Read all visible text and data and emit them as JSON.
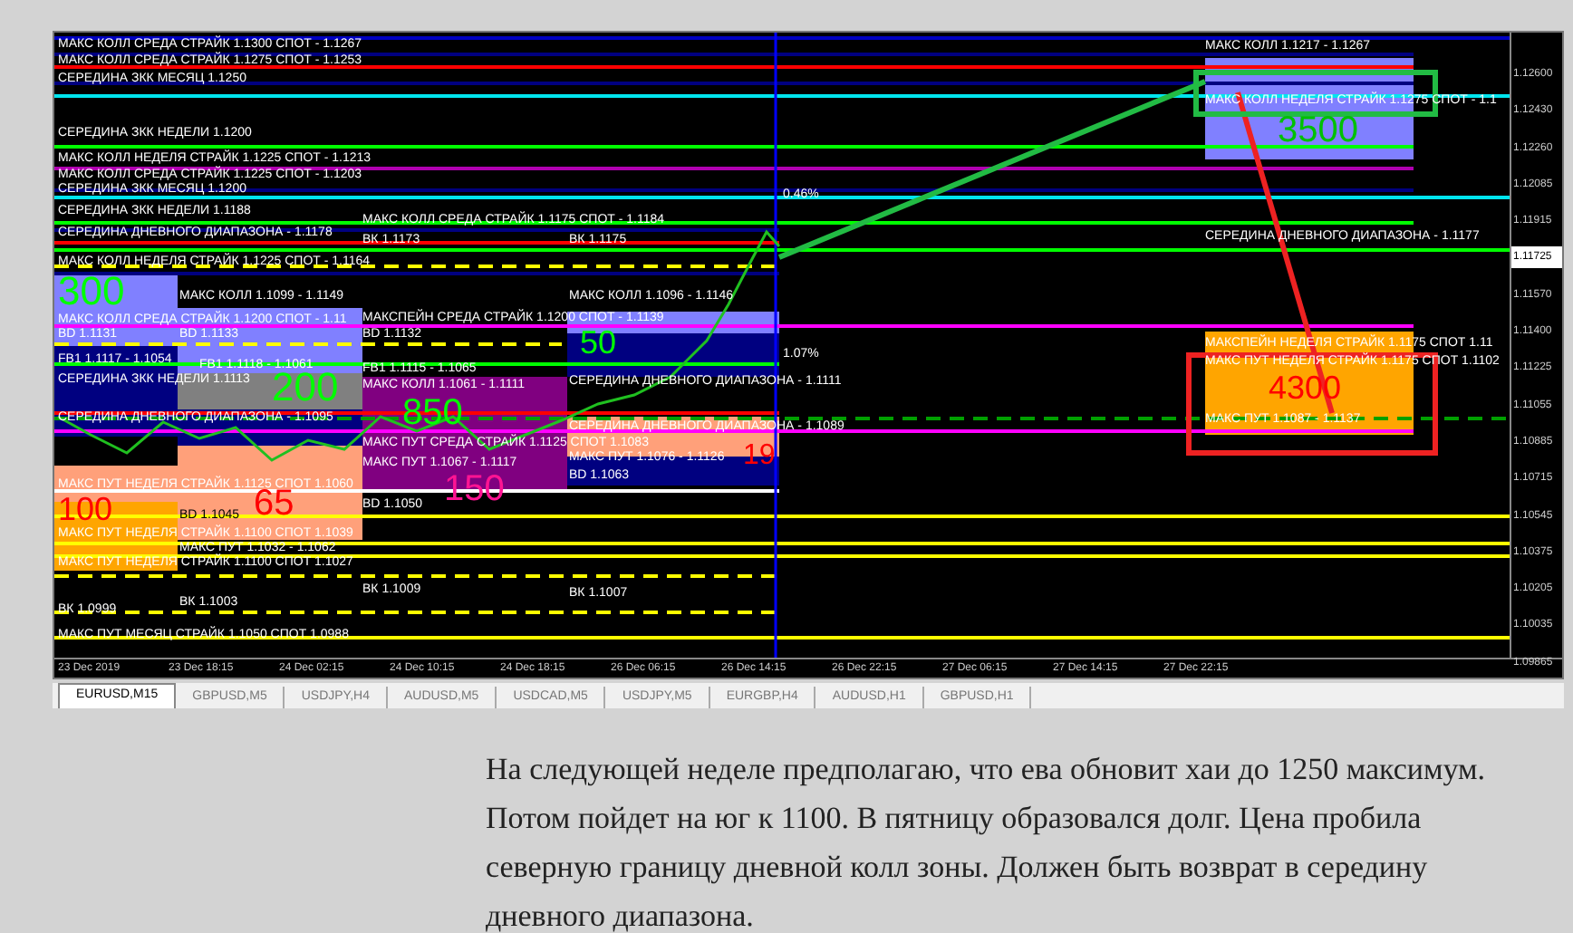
{
  "chart": {
    "level_labels": [
      "МАКС КОЛЛ СРЕДА  СТРАЙК 1.1300 СПОТ - 1.1267",
      "МАКС КОЛЛ СРЕДА  СТРАЙК 1.1275 СПОТ - 1.1253",
      "СЕРЕДИНА ЗКК МЕСЯЦ 1.1250",
      "СЕРЕДИНА ЗКК НЕДЕЛИ 1.1200",
      "МАКС КОЛЛ НЕДЕЛЯ СТРАЙК 1.1225 СПОТ - 1.1213",
      "МАКС КОЛЛ СРЕДА  СТРАЙК 1.1225 СПОТ - 1.1203",
      "СЕРЕДИНА ЗКК МЕСЯЦ 1.1200",
      "СЕРЕДИНА ЗКК НЕДЕЛИ 1.1188",
      "СЕРЕДИНА ДНЕВНОГО ДИАПАЗОНА - 1.1178",
      "МАКС КОЛЛ СРЕДА  СТРАЙК 1.1175 СПОТ - 1.1184",
      "ВК 1.1173",
      "ВК 1.1175",
      "МАКС КОЛЛ НЕДЕЛЯ СТРАЙК 1.1225 СПОТ - 1.1164",
      "МАКС КОЛЛ 1.1099 - 1.1149",
      "МАКС КОЛЛ 1.1096 - 1.1146",
      "МАКС КОЛЛ СРЕДА  СТРАЙК 1.1200 СПОТ - 1.11",
      "BD 1.1131",
      "BD 1.1133",
      "МАКСПЕЙН СРЕДА  СТРАЙК 1.1200  СПОТ - 1.1139",
      "BD 1.1132",
      "FB1 1.1117 - 1.1054",
      "FB1 1.1118 - 1.1061",
      "FB1 1.1115 - 1.1065",
      "СЕРЕДИНА ЗКК НЕДЕЛИ 1.1113",
      "МАКС КОЛЛ 1.1061 - 1.1111",
      "СЕРЕДИНА ДНЕВНОГО ДИАПАЗОНА - 1.1111",
      "СЕРЕДИНА ДНЕВНОГО ДИАПАЗОНА - 1.1095",
      "СЕРЕДИНА ДНЕВНОГО ДИАПАЗОНА - 1.1089",
      "МАКС ПУТ СРЕДА  СТРАЙК 1.1125 СПОТ 1.1083",
      "МАКС ПУТ 1.1067 - 1.1117",
      "МАКС ПУТ 1.1076 - 1.1126",
      "BD 1.1063",
      "МАКС ПУТ НЕДЕЛЯ СТРАЙК 1.1125 СПОТ 1.1060",
      "BD 1.1050",
      "BD 1.1045",
      "МАКС ПУТ НЕДЕЛЯ СТРАЙК 1.1100 СПОТ 1.1039",
      "МАКС ПУТ 1.1032 - 1.1062",
      "МАКС ПУТ НЕДЕЛЯ СТРАЙК 1.1100 СПОТ 1.1027",
      "ВК 1.1009",
      "ВК 1.1007",
      "ВК 1.1003",
      "ВК 1.0999",
      "МАКС ПУТ МЕСЯЦ СТРАЙК 1.1050 СПОТ 1.0988",
      "МАКС КОЛЛ 1.1217 - 1.1267",
      "МАКС КОЛЛ НЕДЕЛЯ СТРАЙК 1.1275 СПОТ - 1.1",
      "СЕРЕДИНА ДНЕВНОГО ДИАПАЗОНА - 1.1177",
      "МАКСПЕЙН НЕДЕЛЯ  СТРАЙК 1.1175 СПОТ  1.11",
      "МАКС ПУТ НЕДЕЛЯ СТРАЙК 1.1175 СПОТ 1.1102",
      "МАКС ПУТ 1.1087 - 1.1137"
    ],
    "percent_labels": [
      "0.46%",
      "1.07%"
    ],
    "zone_numbers": [
      {
        "text": "300",
        "color": "#00ff00"
      },
      {
        "text": "200",
        "color": "#00ff00"
      },
      {
        "text": "850",
        "color": "#00ff00"
      },
      {
        "text": "50",
        "color": "#00ff00"
      },
      {
        "text": "19",
        "color": "#ff0000"
      },
      {
        "text": "150",
        "color": "#ff1493"
      },
      {
        "text": "100",
        "color": "#ff0000"
      },
      {
        "text": "65",
        "color": "#ff0000"
      },
      {
        "text": "3500",
        "color": "#00c000"
      },
      {
        "text": "4300",
        "color": "#ff0000"
      }
    ],
    "price_axis": [
      {
        "text": "1.12600",
        "current": false
      },
      {
        "text": "1.12430",
        "current": false
      },
      {
        "text": "1.12260",
        "current": false
      },
      {
        "text": "1.12085",
        "current": false
      },
      {
        "text": "1.11915",
        "current": false
      },
      {
        "text": "1.11725",
        "current": true
      },
      {
        "text": "1.11570",
        "current": false
      },
      {
        "text": "1.11400",
        "current": false
      },
      {
        "text": "1.11225",
        "current": false
      },
      {
        "text": "1.11055",
        "current": false
      },
      {
        "text": "1.10885",
        "current": false
      },
      {
        "text": "1.10715",
        "current": false
      },
      {
        "text": "1.10545",
        "current": false
      },
      {
        "text": "1.10375",
        "current": false
      },
      {
        "text": "1.10205",
        "current": false
      },
      {
        "text": "1.10035",
        "current": false
      },
      {
        "text": "1.09865",
        "current": false
      }
    ],
    "time_axis": [
      "23 Dec 2019",
      "23 Dec 18:15",
      "24 Dec 02:15",
      "24 Dec 10:15",
      "24 Dec 18:15",
      "26 Dec 06:15",
      "26 Dec 14:15",
      "26 Dec 22:15",
      "27 Dec 06:15",
      "27 Dec 14:15",
      "27 Dec 22:15"
    ]
  },
  "tabs": [
    {
      "label": "EURUSD,M15",
      "selected": true
    },
    {
      "label": "GBPUSD,M5",
      "selected": false
    },
    {
      "label": "USDJPY,H4",
      "selected": false
    },
    {
      "label": "AUDUSD,M5",
      "selected": false
    },
    {
      "label": "USDCAD,M5",
      "selected": false
    },
    {
      "label": "USDJPY,M5",
      "selected": false
    },
    {
      "label": "EURGBP,H4",
      "selected": false
    },
    {
      "label": "AUDUSD,H1",
      "selected": false
    },
    {
      "label": "GBPUSD,H1",
      "selected": false
    }
  ],
  "comment": "На следующей неделе предполагаю, что ева обновит хаи до 1250 максимум. Потом пойдет на юг к 1100. В пятницу образовался долг. Цена пробила северную границу дневной колл зоны. Должен быть возврат в середину дневного диапазона."
}
